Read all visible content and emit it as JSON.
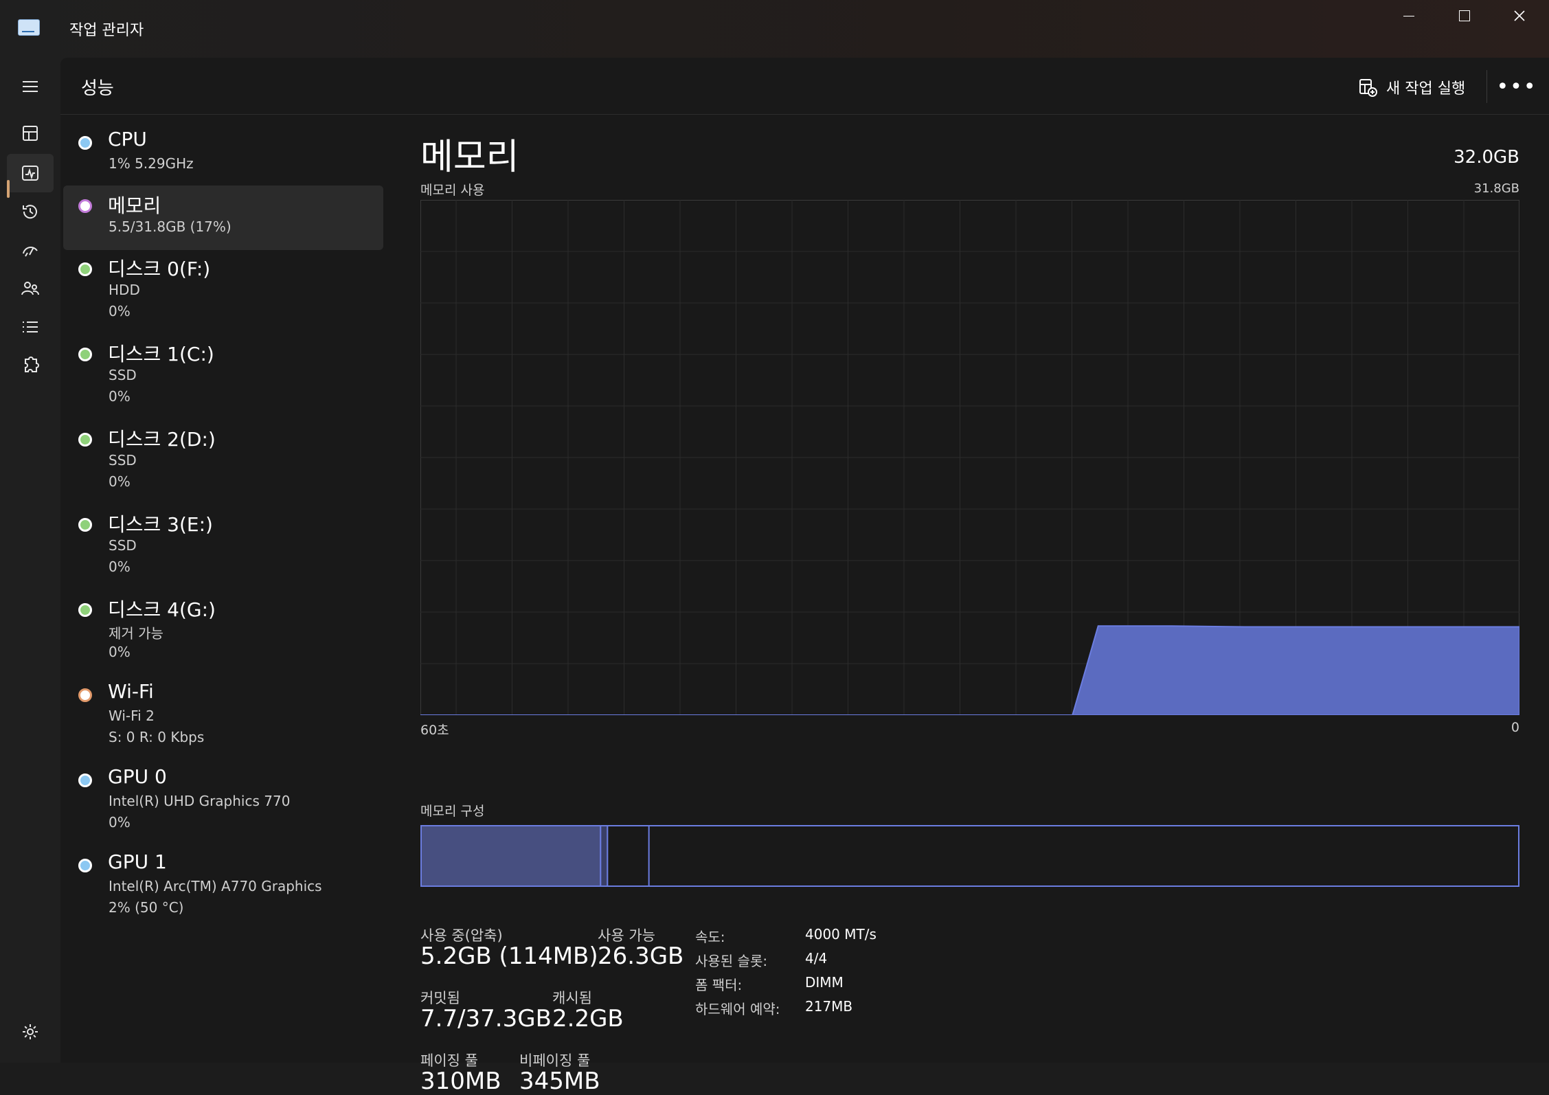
{
  "window": {
    "title": "작업 관리자"
  },
  "colors": {
    "accent": "#d4a373",
    "memory_fill": "#5b6bc0",
    "memory_line": "#6b7de0"
  },
  "header": {
    "title": "성능",
    "run_task_label": "새 작업 실행"
  },
  "resources": [
    {
      "name": "CPU",
      "sub1": "1%  5.29GHz",
      "sub2": "",
      "dot": "#8cc8f2",
      "dot_style": "fill"
    },
    {
      "name": "메모리",
      "sub1": "5.5/31.8GB (17%)",
      "sub2": "",
      "dot": "#c27bd9",
      "dot_style": "ring"
    },
    {
      "name": "디스크 0(F:)",
      "sub1": "HDD",
      "sub2": "0%",
      "dot": "#8fd17a",
      "dot_style": "fill"
    },
    {
      "name": "디스크 1(C:)",
      "sub1": "SSD",
      "sub2": "0%",
      "dot": "#8fd17a",
      "dot_style": "fill"
    },
    {
      "name": "디스크 2(D:)",
      "sub1": "SSD",
      "sub2": "0%",
      "dot": "#8fd17a",
      "dot_style": "fill"
    },
    {
      "name": "디스크 3(E:)",
      "sub1": "SSD",
      "sub2": "0%",
      "dot": "#8fd17a",
      "dot_style": "fill"
    },
    {
      "name": "디스크 4(G:)",
      "sub1": "제거 가능",
      "sub2": "0%",
      "dot": "#8fd17a",
      "dot_style": "fill"
    },
    {
      "name": "Wi-Fi",
      "sub1": "Wi-Fi 2",
      "sub2": "S: 0  R: 0 Kbps",
      "dot": "#e29a6b",
      "dot_style": "ring"
    },
    {
      "name": "GPU 0",
      "sub1": "Intel(R) UHD Graphics 770",
      "sub2": "0%",
      "dot": "#8cc8f2",
      "dot_style": "fill"
    },
    {
      "name": "GPU 1",
      "sub1": "Intel(R) Arc(TM) A770 Graphics",
      "sub2": "2% (50 °C)",
      "dot": "#8cc8f2",
      "dot_style": "fill"
    }
  ],
  "detail": {
    "title": "메모리",
    "total": "32.0GB",
    "chart_label": "메모리 사용",
    "chart_max": "31.8GB",
    "axis_left": "60초",
    "axis_right": "0",
    "composition_label": "메모리 구성"
  },
  "chart_data": {
    "type": "area",
    "x_seconds_ago": [
      60,
      24.4,
      23.0,
      19.0,
      15.0,
      11.0,
      7.0,
      3.0,
      0
    ],
    "y_gb": [
      0,
      0,
      5.5,
      5.5,
      5.45,
      5.45,
      5.45,
      5.45,
      5.45
    ],
    "ylim": [
      0,
      31.8
    ],
    "grid": true
  },
  "composition": {
    "in_use_gb": 5.2,
    "modified_gb": 0.2,
    "standby_gb": 1.2,
    "free_gb": 25.2,
    "total_gb": 31.8
  },
  "stats": {
    "in_use_label": "사용 중(압축)",
    "in_use_value": "5.2GB (114MB)",
    "available_label": "사용 가능",
    "available_value": "26.3GB",
    "committed_label": "커밋됨",
    "committed_value": "7.7/37.3GB",
    "cached_label": "캐시됨",
    "cached_value": "2.2GB",
    "paged_label": "페이징 풀",
    "paged_value": "310MB",
    "nonpaged_label": "비페이징 풀",
    "nonpaged_value": "345MB",
    "speed_label": "속도:",
    "speed_value": "4000 MT/s",
    "slots_label": "사용된 슬롯:",
    "slots_value": "4/4",
    "form_label": "폼 팩터:",
    "form_value": "DIMM",
    "hw_label": "하드웨어 예약:",
    "hw_value": "217MB"
  }
}
